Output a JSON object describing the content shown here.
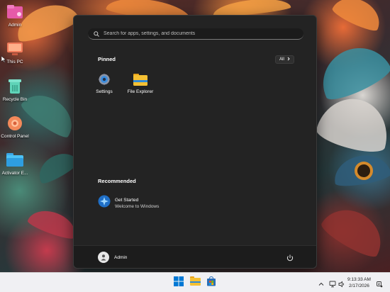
{
  "desktop": {
    "icons": [
      {
        "label": "Admin",
        "icon": "user-folder-icon"
      },
      {
        "label": "This PC",
        "icon": "computer-icon"
      },
      {
        "label": "Recycle Bin",
        "icon": "recycle-bin-icon"
      },
      {
        "label": "Control Panel",
        "icon": "control-panel-icon"
      },
      {
        "label": "Activator E...",
        "icon": "folder-icon"
      }
    ]
  },
  "start_menu": {
    "search": {
      "placeholder": "Search for apps, settings, and documents",
      "icon": "search-icon"
    },
    "pinned": {
      "title": "Pinned",
      "all_label": "All",
      "apps": [
        {
          "label": "Settings",
          "icon": "gear-icon"
        },
        {
          "label": "File Explorer",
          "icon": "file-explorer-icon"
        }
      ]
    },
    "recommended": {
      "title": "Recommended",
      "items": [
        {
          "title": "Get Started",
          "subtitle": "Welcome to Windows",
          "icon": "get-started-icon"
        }
      ]
    },
    "footer": {
      "user_name": "Admin",
      "power_icon": "power-icon"
    }
  },
  "taskbar": {
    "items": [
      "windows-start-icon",
      "file-explorer-icon",
      "microsoft-store-icon"
    ],
    "tray": [
      "chevron-up-icon",
      "network-icon",
      "volume-icon",
      "notification-icon"
    ],
    "clock": {
      "time": "9:13:33 AM",
      "date": "2/17/2026"
    }
  },
  "colors": {
    "accent": "#0078d4",
    "menu_bg": "#232323",
    "taskbar_bg": "#f0f0f3"
  }
}
